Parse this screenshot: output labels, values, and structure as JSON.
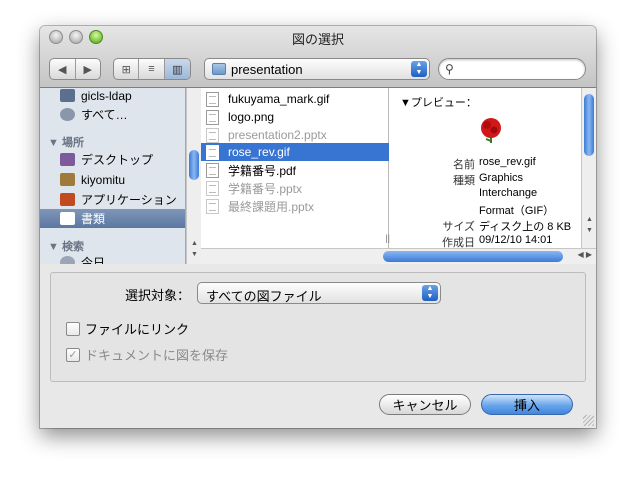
{
  "window": {
    "title": "図の選択"
  },
  "toolbar": {
    "back_glyph": "◀",
    "forward_glyph": "▶",
    "view_icon_glyph": "⊞",
    "view_list_glyph": "≡",
    "view_column_glyph": "▥",
    "location": "presentation",
    "search_value": "",
    "search_glyph": "🔍"
  },
  "sidebar": {
    "items_top": [
      {
        "label": "gicls-ldap",
        "icon": "network-disk-icon"
      },
      {
        "label": "すべて…",
        "icon": "network-globe-icon"
      }
    ],
    "places_header": "▼ 場所",
    "places": [
      {
        "label": "デスクトップ",
        "icon": "desktop-icon",
        "color": "#7d5a9a"
      },
      {
        "label": "kiyomitu",
        "icon": "home-icon",
        "color": "#a07a3a"
      },
      {
        "label": "アプリケーション",
        "icon": "applications-icon",
        "color": "#c24a1f"
      },
      {
        "label": "書類",
        "icon": "documents-icon",
        "color": "#ffffff",
        "selected": true
      }
    ],
    "search_header": "▼ 検索",
    "search_partial": "今日"
  },
  "files": [
    {
      "name": "fukuyama_mark.gif",
      "dim": false,
      "selected": false
    },
    {
      "name": "logo.png",
      "dim": false,
      "selected": false
    },
    {
      "name": "presentation2.pptx",
      "dim": true,
      "selected": false
    },
    {
      "name": "rose_rev.gif",
      "dim": false,
      "selected": true
    },
    {
      "name": "学籍番号.pdf",
      "dim": false,
      "selected": false
    },
    {
      "name": "学籍番号.pptx",
      "dim": true,
      "selected": false
    },
    {
      "name": "最終課題用.pptx",
      "dim": true,
      "selected": false
    }
  ],
  "preview": {
    "header": "▼プレビュー：",
    "name_key": "名前",
    "name_val": "rose_rev.gif",
    "kind_key": "種類",
    "kind_lines": [
      "Graphics",
      "Interchange",
      "Format（GIF）"
    ],
    "size_key": "サイズ",
    "size_val": "ディスク上の 8 KB",
    "created_key": "作成日",
    "created_val": "09/12/10 14:01"
  },
  "options": {
    "filter_label": "選択対象：",
    "filter_value": "すべての図ファイル",
    "link_label": "ファイルにリンク",
    "save_label": "ドキュメントに図を保存",
    "save_checked_glyph": "✓"
  },
  "buttons": {
    "cancel": "キャンセル",
    "insert": "挿入"
  },
  "colors": {
    "selection": "#3874d1",
    "sidebar_bg": "#dfe5ec",
    "accent": "#3e86e0"
  }
}
